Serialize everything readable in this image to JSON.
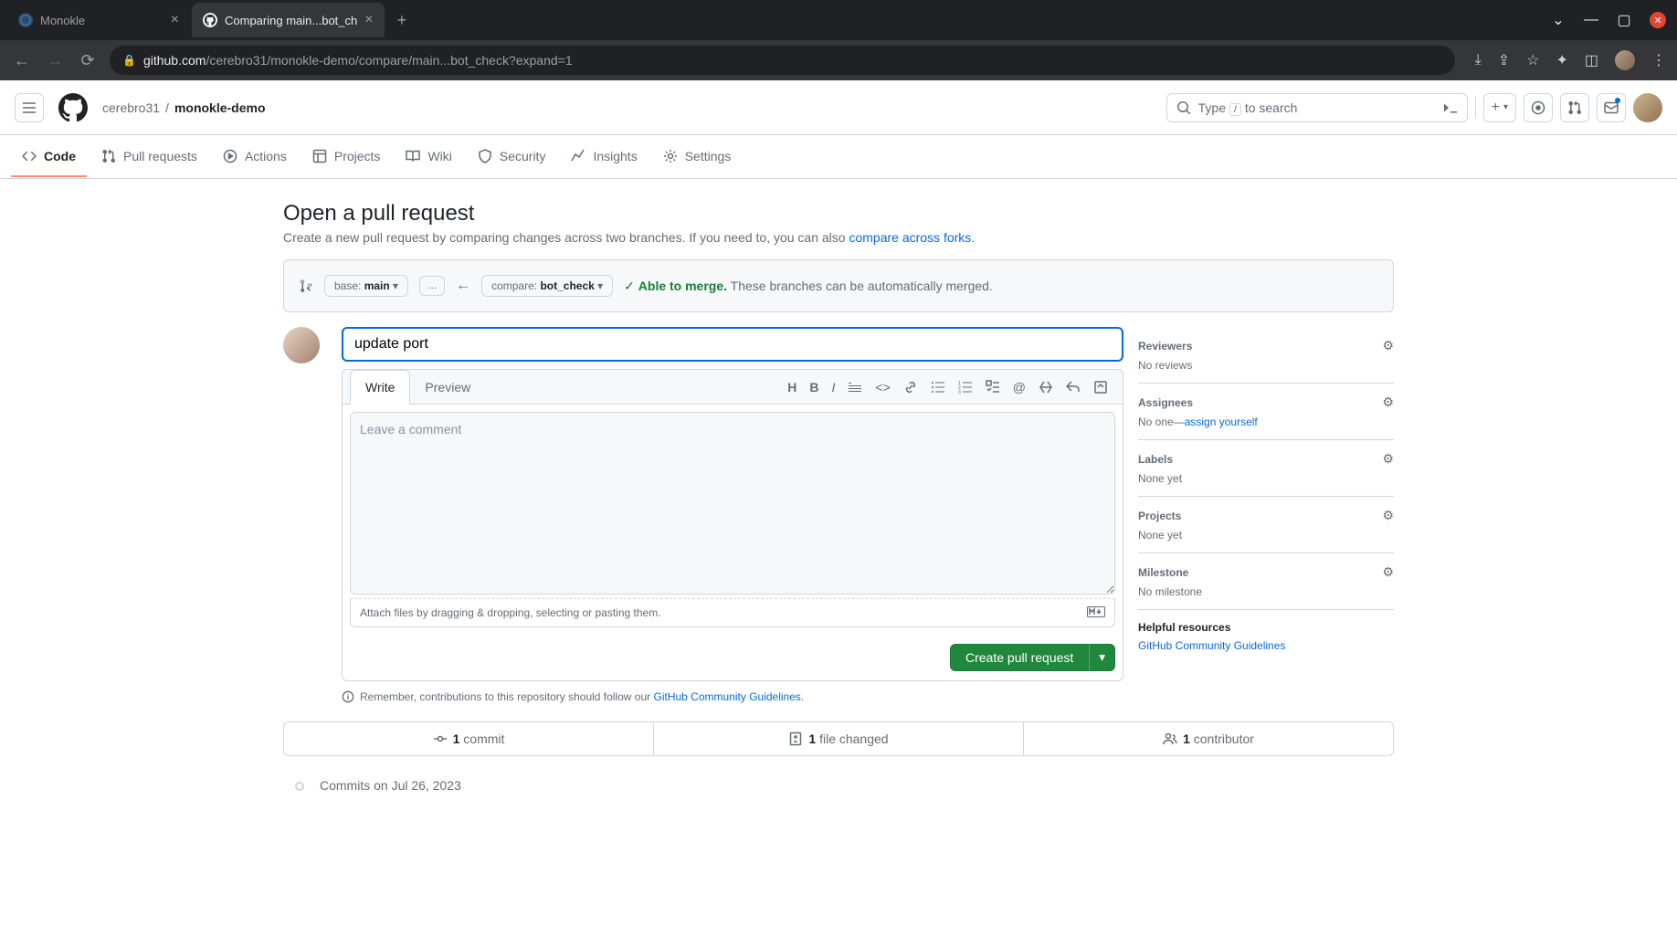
{
  "browser": {
    "tabs": [
      {
        "title": "Monokle",
        "active": false
      },
      {
        "title": "Comparing main...bot_ch",
        "active": true
      }
    ],
    "url_host": "github.com",
    "url_path": "/cerebro31/monokle-demo/compare/main...bot_check?expand=1"
  },
  "gh_header": {
    "owner": "cerebro31",
    "repo": "monokle-demo",
    "search_placeholder_pre": "Type ",
    "search_slash": "/",
    "search_placeholder_post": " to search"
  },
  "repo_nav": {
    "code": "Code",
    "prs": "Pull requests",
    "actions": "Actions",
    "projects": "Projects",
    "wiki": "Wiki",
    "security": "Security",
    "insights": "Insights",
    "settings": "Settings"
  },
  "page": {
    "title": "Open a pull request",
    "subtitle_pre": "Create a new pull request by comparing changes across two branches. If you need to, you can also ",
    "subtitle_link": "compare across forks",
    "subtitle_post": "."
  },
  "compare": {
    "base_label": "base: ",
    "base_branch": "main",
    "compare_label": "compare: ",
    "compare_branch": "bot_check",
    "able": "Able to merge.",
    "able_text": " These branches can be automatically merged."
  },
  "pr_form": {
    "title_value": "update port",
    "tab_write": "Write",
    "tab_preview": "Preview",
    "comment_placeholder": "Leave a comment",
    "attach_text": "Attach files by dragging & dropping, selecting or pasting them.",
    "create_btn": "Create pull request",
    "guidelines_pre": "Remember, contributions to this repository should follow our ",
    "guidelines_link": "GitHub Community Guidelines",
    "guidelines_post": "."
  },
  "sidebar": {
    "reviewers": {
      "title": "Reviewers",
      "content": "No reviews"
    },
    "assignees": {
      "title": "Assignees",
      "content_pre": "No one—",
      "content_link": "assign yourself"
    },
    "labels": {
      "title": "Labels",
      "content": "None yet"
    },
    "projects": {
      "title": "Projects",
      "content": "None yet"
    },
    "milestone": {
      "title": "Milestone",
      "content": "No milestone"
    },
    "resources_title": "Helpful resources",
    "resources_link": "GitHub Community Guidelines"
  },
  "stats": {
    "commits_n": "1",
    "commits_txt": " commit",
    "files_n": "1",
    "files_txt": " file changed",
    "contrib_n": "1",
    "contrib_txt": " contributor"
  },
  "timeline": {
    "heading": "Commits on Jul 26, 2023"
  }
}
